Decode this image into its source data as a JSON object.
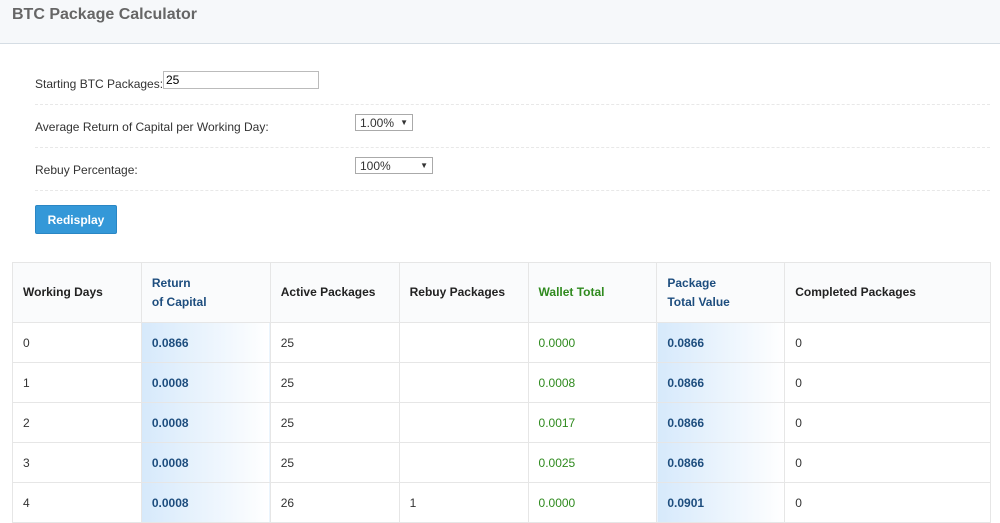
{
  "header": {
    "title": "BTC Package Calculator"
  },
  "form": {
    "starting_label": "Starting BTC Packages:",
    "starting_value": "25",
    "return_label": "Average Return of Capital per Working Day:",
    "return_value": "1.00%",
    "rebuy_label": "Rebuy Percentage:",
    "rebuy_value": "100%",
    "redisplay": "Redisplay"
  },
  "table": {
    "headers": [
      "Working Days",
      "Return\nof Capital",
      "Active Packages",
      "Rebuy Packages",
      "Wallet Total",
      "Package\nTotal Value",
      "Completed Packages"
    ],
    "header_lines": [
      [
        "Working Days"
      ],
      [
        "Return",
        "of Capital"
      ],
      [
        "Active Packages"
      ],
      [
        "Rebuy Packages"
      ],
      [
        "Wallet Total"
      ],
      [
        "Package",
        "Total Value"
      ],
      [
        "Completed Packages"
      ]
    ],
    "rows": [
      [
        "0",
        "0.0866",
        "25",
        "",
        "0.0000",
        "0.0866",
        "0"
      ],
      [
        "1",
        "0.0008",
        "25",
        "",
        "0.0008",
        "0.0866",
        "0"
      ],
      [
        "2",
        "0.0008",
        "25",
        "",
        "0.0017",
        "0.0866",
        "0"
      ],
      [
        "3",
        "0.0008",
        "25",
        "",
        "0.0025",
        "0.0866",
        "0"
      ],
      [
        "4",
        "0.0008",
        "26",
        "1",
        "0.0000",
        "0.0901",
        "0"
      ]
    ]
  },
  "colors": {
    "accent": "#3498d8",
    "wallet_green": "#2f8a1e",
    "value_blue": "#1d4d7e"
  }
}
